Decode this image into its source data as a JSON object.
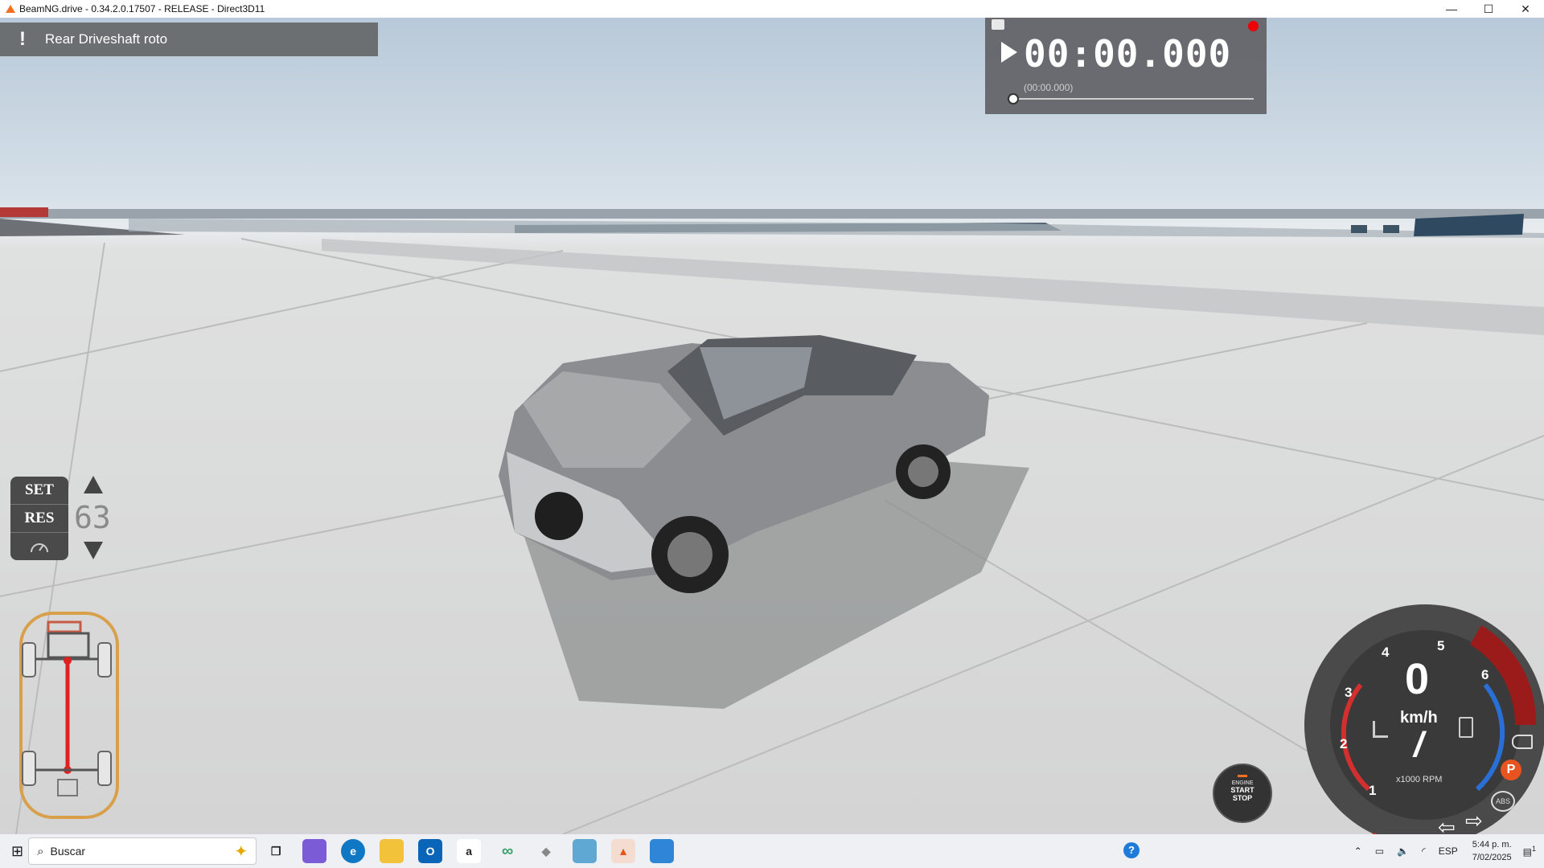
{
  "window": {
    "title": "BeamNG.drive - 0.34.2.0.17507 - RELEASE - Direct3D11",
    "controls": {
      "minimize": "—",
      "maximize": "☐",
      "close": "✕"
    }
  },
  "notification": {
    "icon": "!",
    "text": "Rear Driveshaft roto"
  },
  "replay": {
    "time": "00:00.000",
    "sub_time": "(00:00.000)"
  },
  "cruise_control": {
    "set_label": "SET",
    "res_label": "RES",
    "speed": "63"
  },
  "gauge": {
    "speed": "0",
    "speed_unit": "km/h",
    "gear": "/",
    "rpm_unit": "x1000 RPM",
    "ticks": [
      "1",
      "2",
      "3",
      "4",
      "5",
      "6"
    ],
    "abs_label": "ABS",
    "park_label": "P",
    "colors": {
      "redline": "#9b1b1b",
      "temp": "#d32f2f",
      "fuel": "#2a6fd6"
    }
  },
  "engine_button": {
    "line1": "ENGINE",
    "line2": "START",
    "line3": "STOP"
  },
  "taskbar": {
    "search_placeholder": "Buscar",
    "language": "ESP",
    "time": "5:44 p. m.",
    "date": "7/02/2025",
    "notification_count": "1",
    "apps": [
      "task-view",
      "copilot",
      "edge",
      "file-explorer",
      "outlook",
      "amazon",
      "infinity",
      "dropbox",
      "app-blue",
      "beamng",
      "app-photo"
    ]
  }
}
